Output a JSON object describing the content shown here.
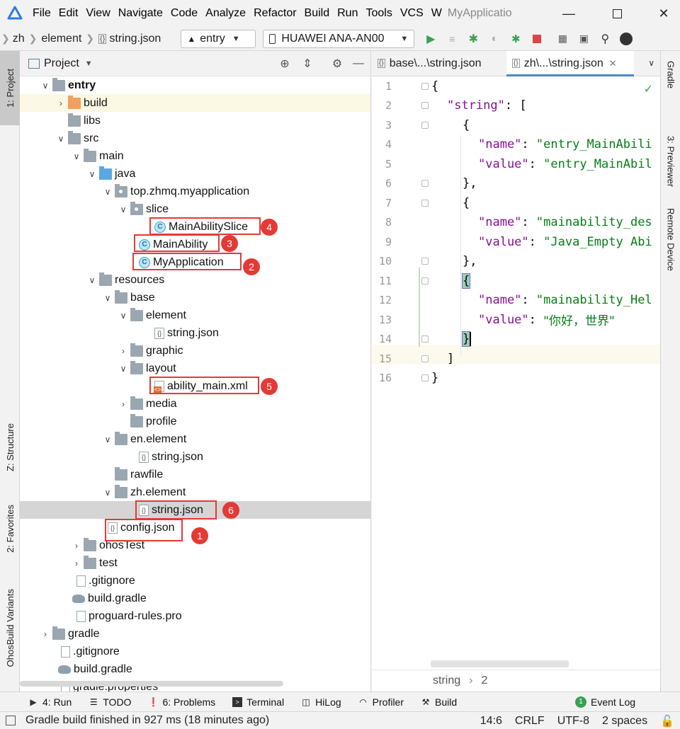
{
  "menu": {
    "items": [
      "File",
      "Edit",
      "View",
      "Navigate",
      "Code",
      "Analyze",
      "Refactor",
      "Build",
      "Run",
      "Tools",
      "VCS",
      "W"
    ],
    "window_title": "MyApplicatio"
  },
  "navbar": {
    "breadcrumbs": [
      "zh",
      "element",
      "string.json"
    ],
    "config_combo": "entry",
    "device_combo": "HUAWEI ANA-AN00"
  },
  "left_strip": {
    "project_tab": "1: Project",
    "structure_tab": "Z: Structure",
    "favorites_tab": "2: Favorites",
    "build_variants_tab": "OhosBuild Variants"
  },
  "right_strip": {
    "gradle_tab": "Gradle",
    "previewer_tab": "3: Previewer",
    "remote_device_tab": "Remote Device"
  },
  "project_panel": {
    "title": "Project",
    "tree": [
      {
        "label": "entry",
        "bold": true
      },
      {
        "label": "build"
      },
      {
        "label": "libs"
      },
      {
        "label": "src"
      },
      {
        "label": "main"
      },
      {
        "label": "java"
      },
      {
        "label": "top.zhmq.myapplication"
      },
      {
        "label": "slice"
      },
      {
        "label": "MainAbilitySlice"
      },
      {
        "label": "MainAbility"
      },
      {
        "label": "MyApplication"
      },
      {
        "label": "resources"
      },
      {
        "label": "base"
      },
      {
        "label": "element"
      },
      {
        "label": "string.json"
      },
      {
        "label": "graphic"
      },
      {
        "label": "layout"
      },
      {
        "label": "ability_main.xml"
      },
      {
        "label": "media"
      },
      {
        "label": "profile"
      },
      {
        "label": "en.element"
      },
      {
        "label": "string.json"
      },
      {
        "label": "rawfile"
      },
      {
        "label": "zh.element"
      },
      {
        "label": "string.json"
      },
      {
        "label": "config.json"
      },
      {
        "label": "ohosTest"
      },
      {
        "label": "test"
      },
      {
        "label": ".gitignore"
      },
      {
        "label": "build.gradle"
      },
      {
        "label": "proguard-rules.pro"
      },
      {
        "label": "gradle"
      },
      {
        "label": ".gitignore"
      },
      {
        "label": "build.gradle"
      },
      {
        "label": "gradle.properties"
      }
    ],
    "annotations": [
      "1",
      "2",
      "3",
      "4",
      "5",
      "6"
    ]
  },
  "editor": {
    "tabs": [
      {
        "label": "base\\...\\string.json"
      },
      {
        "label": "zh\\...\\string.json"
      }
    ],
    "line_numbers": [
      "1",
      "2",
      "3",
      "4",
      "5",
      "6",
      "7",
      "8",
      "9",
      "10",
      "11",
      "12",
      "13",
      "14",
      "15",
      "16"
    ],
    "code_lines": [
      {
        "punct": "{"
      },
      {
        "key": "\"string\"",
        "punct": ": ["
      },
      {
        "punct": "{"
      },
      {
        "key": "\"name\"",
        "punct": ": ",
        "value": "\"entry_MainAbili"
      },
      {
        "key": "\"value\"",
        "punct": ": ",
        "value": "\"entry_MainAbil"
      },
      {
        "punct": "},"
      },
      {
        "punct": "{"
      },
      {
        "key": "\"name\"",
        "punct": ": ",
        "value": "\"mainability_des"
      },
      {
        "key": "\"value\"",
        "punct": ": ",
        "value": "\"Java_Empty Abi"
      },
      {
        "punct": "},"
      },
      {
        "punct": "{"
      },
      {
        "key": "\"name\"",
        "punct": ": ",
        "value": "\"mainability_Hel"
      },
      {
        "key": "\"value\"",
        "punct": ": ",
        "value": "\"你好，世界\""
      },
      {
        "punct": "}"
      },
      {
        "punct": "]"
      },
      {
        "punct": "}"
      }
    ],
    "breadcrumb": [
      "string",
      "2"
    ]
  },
  "bottom_tools": [
    {
      "label": "4: Run",
      "icon": "run-icon"
    },
    {
      "label": "TODO",
      "icon": "todo-icon"
    },
    {
      "label": "6: Problems",
      "icon": "problems-icon"
    },
    {
      "label": "Terminal",
      "icon": "terminal-icon"
    },
    {
      "label": "HiLog",
      "icon": "hilog-icon"
    },
    {
      "label": "Profiler",
      "icon": "profiler-icon"
    },
    {
      "label": "Build",
      "icon": "build-icon"
    }
  ],
  "event_log": {
    "label": "Event Log",
    "count": "1"
  },
  "status": {
    "message": "Gradle build finished in 927 ms (18 minutes ago)",
    "position": "14:6",
    "line_sep": "CRLF",
    "encoding": "UTF-8",
    "indent": "2 spaces"
  },
  "colors": {
    "accent": "#4a88c7",
    "annotation_red": "#e53935",
    "run_green": "#3aa055",
    "stop_red": "#e04444"
  }
}
